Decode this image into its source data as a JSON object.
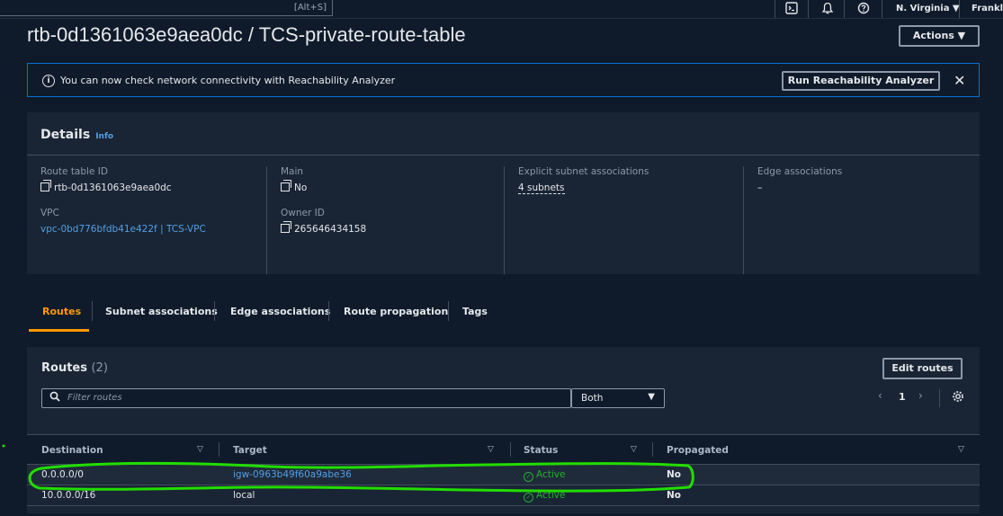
{
  "topbar": {
    "search_hint": "[Alt+S]",
    "region": "N. Virginia ▼",
    "account": "Franklin"
  },
  "page": {
    "title": "rtb-0d1361063e9aea0dc / TCS-private-route-table",
    "actions_label": "Actions ▼"
  },
  "banner": {
    "message": "You can now check network connectivity with Reachability Analyzer",
    "button_label": "Run Reachability Analyzer",
    "close": "✕"
  },
  "details": {
    "heading": "Details",
    "info": "Info",
    "route_table_id_label": "Route table ID",
    "route_table_id": "rtb-0d1361063e9aea0dc",
    "vpc_label": "VPC",
    "vpc": "vpc-0bd776bfdb41e422f | TCS-VPC",
    "main_label": "Main",
    "main": "No",
    "owner_label": "Owner ID",
    "owner": "265646434158",
    "explicit_label": "Explicit subnet associations",
    "explicit": "4 subnets",
    "edge_label": "Edge associations",
    "edge": "–"
  },
  "tabs": [
    {
      "label": "Routes"
    },
    {
      "label": "Subnet associations"
    },
    {
      "label": "Edge associations"
    },
    {
      "label": "Route propagation"
    },
    {
      "label": "Tags"
    }
  ],
  "routes": {
    "title": "Routes",
    "count": "(2)",
    "edit_label": "Edit routes",
    "filter_placeholder": "Filter routes",
    "select_value": "Both",
    "page": "1",
    "columns": [
      "Destination",
      "Target",
      "Status",
      "Propagated"
    ],
    "rows": [
      {
        "destination": "0.0.0.0/0",
        "target": "igw-0963b49f60a9abe36",
        "status": "Active",
        "propagated": "No"
      },
      {
        "destination": "10.0.0.0/16",
        "target": "local",
        "status": "Active",
        "propagated": "No"
      }
    ]
  },
  "colors": {
    "accent": "#ff9900",
    "link": "#539fe5",
    "status_ok": "#29ad32",
    "annotation": "#22dd00"
  }
}
